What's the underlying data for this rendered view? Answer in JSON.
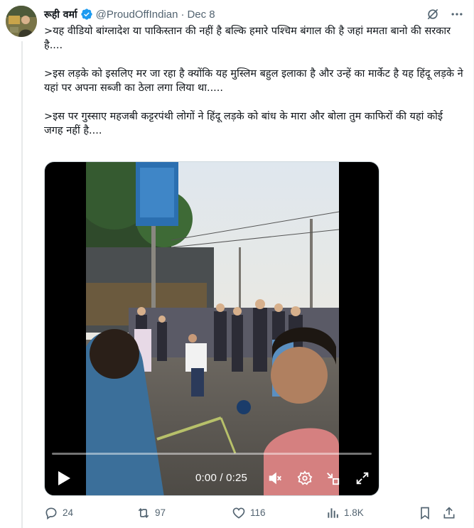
{
  "tweet": {
    "author_name": "रूही वर्मा",
    "handle": "@ProudOffIndian",
    "separator": "·",
    "date": "Dec 8",
    "paragraphs": [
      ">यह वीडियो बांग्लादेश या पाकिस्तान की नहीं है बल्कि हमारे पश्चिम बंगाल की है जहां ममता बानो की सरकार है....",
      ">इस लड़के को इसलिए मर जा रहा है क्योंकि यह मुस्लिम बहुल इलाका है और उन्हें का मार्केट है यह हिंदू लड़के ने यहां पर अपना सब्जी का ठेला लगा लिया था.....",
      ">इस पर गुस्साए महजबी कट्टरपंथी लोगों ने हिंदू लड़के को बांध के मारा और बोला तुम काफिरों की यहां कोई जगह नहीं है...."
    ]
  },
  "video": {
    "time": "0:00 / 0:25",
    "progress": 0
  },
  "actions": {
    "replies": "24",
    "reposts": "97",
    "likes": "116",
    "views": "1.8K"
  },
  "icons": [
    "verified-badge-icon",
    "grok-icon",
    "more-icon",
    "play-icon",
    "volume-icon",
    "settings-icon",
    "minimize-icon",
    "fullscreen-icon",
    "reply-icon",
    "repost-icon",
    "like-icon",
    "views-icon",
    "bookmark-icon",
    "share-icon"
  ],
  "colors": {
    "accent": "#1d9bf0",
    "secondary_text": "#536471"
  }
}
